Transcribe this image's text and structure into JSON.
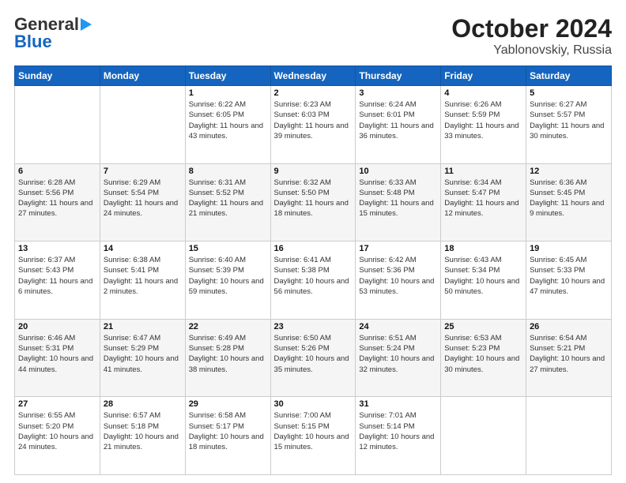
{
  "header": {
    "logo_general": "General",
    "logo_blue": "Blue",
    "month_title": "October 2024",
    "location": "Yablonovskiy, Russia"
  },
  "weekdays": [
    "Sunday",
    "Monday",
    "Tuesday",
    "Wednesday",
    "Thursday",
    "Friday",
    "Saturday"
  ],
  "weeks": [
    [
      {
        "day": "",
        "sunrise": "",
        "sunset": "",
        "daylight": ""
      },
      {
        "day": "",
        "sunrise": "",
        "sunset": "",
        "daylight": ""
      },
      {
        "day": "1",
        "sunrise": "Sunrise: 6:22 AM",
        "sunset": "Sunset: 6:05 PM",
        "daylight": "Daylight: 11 hours and 43 minutes."
      },
      {
        "day": "2",
        "sunrise": "Sunrise: 6:23 AM",
        "sunset": "Sunset: 6:03 PM",
        "daylight": "Daylight: 11 hours and 39 minutes."
      },
      {
        "day": "3",
        "sunrise": "Sunrise: 6:24 AM",
        "sunset": "Sunset: 6:01 PM",
        "daylight": "Daylight: 11 hours and 36 minutes."
      },
      {
        "day": "4",
        "sunrise": "Sunrise: 6:26 AM",
        "sunset": "Sunset: 5:59 PM",
        "daylight": "Daylight: 11 hours and 33 minutes."
      },
      {
        "day": "5",
        "sunrise": "Sunrise: 6:27 AM",
        "sunset": "Sunset: 5:57 PM",
        "daylight": "Daylight: 11 hours and 30 minutes."
      }
    ],
    [
      {
        "day": "6",
        "sunrise": "Sunrise: 6:28 AM",
        "sunset": "Sunset: 5:56 PM",
        "daylight": "Daylight: 11 hours and 27 minutes."
      },
      {
        "day": "7",
        "sunrise": "Sunrise: 6:29 AM",
        "sunset": "Sunset: 5:54 PM",
        "daylight": "Daylight: 11 hours and 24 minutes."
      },
      {
        "day": "8",
        "sunrise": "Sunrise: 6:31 AM",
        "sunset": "Sunset: 5:52 PM",
        "daylight": "Daylight: 11 hours and 21 minutes."
      },
      {
        "day": "9",
        "sunrise": "Sunrise: 6:32 AM",
        "sunset": "Sunset: 5:50 PM",
        "daylight": "Daylight: 11 hours and 18 minutes."
      },
      {
        "day": "10",
        "sunrise": "Sunrise: 6:33 AM",
        "sunset": "Sunset: 5:48 PM",
        "daylight": "Daylight: 11 hours and 15 minutes."
      },
      {
        "day": "11",
        "sunrise": "Sunrise: 6:34 AM",
        "sunset": "Sunset: 5:47 PM",
        "daylight": "Daylight: 11 hours and 12 minutes."
      },
      {
        "day": "12",
        "sunrise": "Sunrise: 6:36 AM",
        "sunset": "Sunset: 5:45 PM",
        "daylight": "Daylight: 11 hours and 9 minutes."
      }
    ],
    [
      {
        "day": "13",
        "sunrise": "Sunrise: 6:37 AM",
        "sunset": "Sunset: 5:43 PM",
        "daylight": "Daylight: 11 hours and 6 minutes."
      },
      {
        "day": "14",
        "sunrise": "Sunrise: 6:38 AM",
        "sunset": "Sunset: 5:41 PM",
        "daylight": "Daylight: 11 hours and 2 minutes."
      },
      {
        "day": "15",
        "sunrise": "Sunrise: 6:40 AM",
        "sunset": "Sunset: 5:39 PM",
        "daylight": "Daylight: 10 hours and 59 minutes."
      },
      {
        "day": "16",
        "sunrise": "Sunrise: 6:41 AM",
        "sunset": "Sunset: 5:38 PM",
        "daylight": "Daylight: 10 hours and 56 minutes."
      },
      {
        "day": "17",
        "sunrise": "Sunrise: 6:42 AM",
        "sunset": "Sunset: 5:36 PM",
        "daylight": "Daylight: 10 hours and 53 minutes."
      },
      {
        "day": "18",
        "sunrise": "Sunrise: 6:43 AM",
        "sunset": "Sunset: 5:34 PM",
        "daylight": "Daylight: 10 hours and 50 minutes."
      },
      {
        "day": "19",
        "sunrise": "Sunrise: 6:45 AM",
        "sunset": "Sunset: 5:33 PM",
        "daylight": "Daylight: 10 hours and 47 minutes."
      }
    ],
    [
      {
        "day": "20",
        "sunrise": "Sunrise: 6:46 AM",
        "sunset": "Sunset: 5:31 PM",
        "daylight": "Daylight: 10 hours and 44 minutes."
      },
      {
        "day": "21",
        "sunrise": "Sunrise: 6:47 AM",
        "sunset": "Sunset: 5:29 PM",
        "daylight": "Daylight: 10 hours and 41 minutes."
      },
      {
        "day": "22",
        "sunrise": "Sunrise: 6:49 AM",
        "sunset": "Sunset: 5:28 PM",
        "daylight": "Daylight: 10 hours and 38 minutes."
      },
      {
        "day": "23",
        "sunrise": "Sunrise: 6:50 AM",
        "sunset": "Sunset: 5:26 PM",
        "daylight": "Daylight: 10 hours and 35 minutes."
      },
      {
        "day": "24",
        "sunrise": "Sunrise: 6:51 AM",
        "sunset": "Sunset: 5:24 PM",
        "daylight": "Daylight: 10 hours and 32 minutes."
      },
      {
        "day": "25",
        "sunrise": "Sunrise: 6:53 AM",
        "sunset": "Sunset: 5:23 PM",
        "daylight": "Daylight: 10 hours and 30 minutes."
      },
      {
        "day": "26",
        "sunrise": "Sunrise: 6:54 AM",
        "sunset": "Sunset: 5:21 PM",
        "daylight": "Daylight: 10 hours and 27 minutes."
      }
    ],
    [
      {
        "day": "27",
        "sunrise": "Sunrise: 6:55 AM",
        "sunset": "Sunset: 5:20 PM",
        "daylight": "Daylight: 10 hours and 24 minutes."
      },
      {
        "day": "28",
        "sunrise": "Sunrise: 6:57 AM",
        "sunset": "Sunset: 5:18 PM",
        "daylight": "Daylight: 10 hours and 21 minutes."
      },
      {
        "day": "29",
        "sunrise": "Sunrise: 6:58 AM",
        "sunset": "Sunset: 5:17 PM",
        "daylight": "Daylight: 10 hours and 18 minutes."
      },
      {
        "day": "30",
        "sunrise": "Sunrise: 7:00 AM",
        "sunset": "Sunset: 5:15 PM",
        "daylight": "Daylight: 10 hours and 15 minutes."
      },
      {
        "day": "31",
        "sunrise": "Sunrise: 7:01 AM",
        "sunset": "Sunset: 5:14 PM",
        "daylight": "Daylight: 10 hours and 12 minutes."
      },
      {
        "day": "",
        "sunrise": "",
        "sunset": "",
        "daylight": ""
      },
      {
        "day": "",
        "sunrise": "",
        "sunset": "",
        "daylight": ""
      }
    ]
  ]
}
